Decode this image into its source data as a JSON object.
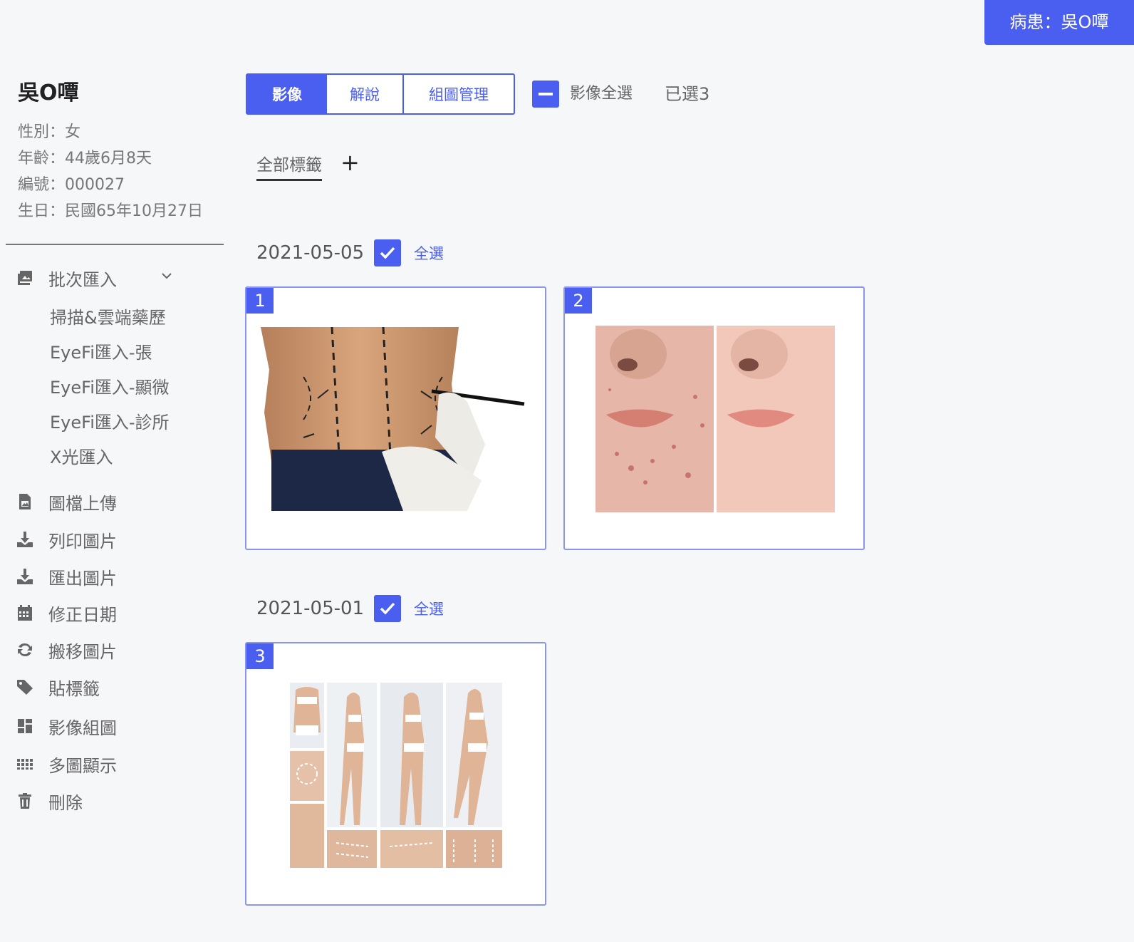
{
  "patient_badge": "病患：吳O嘾",
  "patient": {
    "name": "吳O嘾",
    "gender": "性別：女",
    "age": "年齡：44歲6月8天",
    "number": "編號：000027",
    "birthday": "生日：民國65年10月27日"
  },
  "menu": {
    "batch_import": "批次匯入",
    "sub_items": [
      "掃描&雲端藥歷",
      "EyeFi匯入-張",
      "EyeFi匯入-顯微",
      "EyeFi匯入-診所",
      "X光匯入"
    ],
    "items": [
      {
        "label": "圖檔上傳",
        "icon": "file-image-icon"
      },
      {
        "label": "列印圖片",
        "icon": "download-icon"
      },
      {
        "label": "匯出圖片",
        "icon": "download-icon"
      },
      {
        "label": "修正日期",
        "icon": "calendar-icon"
      },
      {
        "label": "搬移圖片",
        "icon": "refresh-icon"
      },
      {
        "label": "貼標籤",
        "icon": "tag-icon"
      },
      {
        "label": "影像組圖",
        "icon": "dashboard-icon"
      },
      {
        "label": "多圖顯示",
        "icon": "grid-icon"
      },
      {
        "label": "刪除",
        "icon": "trash-icon"
      }
    ]
  },
  "tabs": [
    "影像",
    "解說",
    "組圖管理"
  ],
  "select_all_label": "影像全選",
  "selected_count": "已選3",
  "tag_all": "全部標籤",
  "tag_add": "+",
  "groups": [
    {
      "date": "2021-05-05",
      "select_all": "全選",
      "images": [
        {
          "num": "1"
        },
        {
          "num": "2"
        }
      ]
    },
    {
      "date": "2021-05-01",
      "select_all": "全選",
      "images": [
        {
          "num": "3"
        }
      ]
    }
  ],
  "colors": {
    "accent": "#4a5fef",
    "card_border": "#8b95f0",
    "background": "#f5f7f9"
  }
}
